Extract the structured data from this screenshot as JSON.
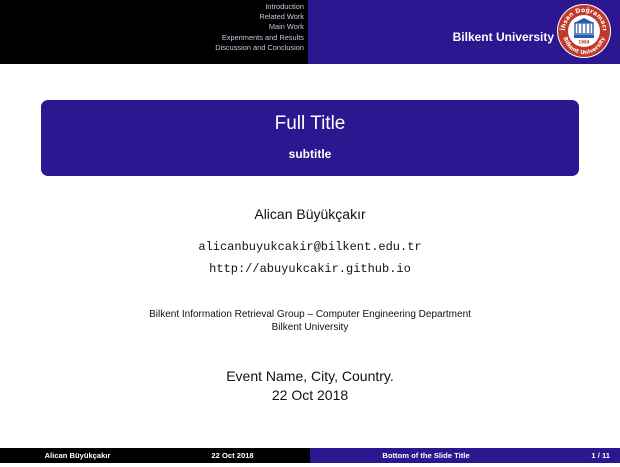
{
  "header": {
    "nav_items": [
      "Introduction",
      "Related Work",
      "Main Work",
      "Experiments and Results",
      "Discussion and Conclusion"
    ],
    "university": "Bilkent University",
    "logo": {
      "top_text": "İhsan Doğramacı",
      "bottom_text": "Bilkent University",
      "year": "1984",
      "colors": {
        "ring": "#c0392b",
        "inner": "#ffffff",
        "seal": "#2a5ba8"
      }
    }
  },
  "title": {
    "main": "Full Title",
    "subtitle": "subtitle"
  },
  "author": {
    "name": "Alican Büyükçakır",
    "email": "alicanbuyukcakir@bilkent.edu.tr",
    "url": "http://abuyukcakir.github.io"
  },
  "institute": {
    "line1": "Bilkent Information Retrieval Group – Computer Engineering Department",
    "line2": "Bilkent University"
  },
  "event": {
    "name": "Event Name, City, Country.",
    "date": "22 Oct 2018"
  },
  "footer": {
    "author": "Alican Büyükçakır",
    "date": "22 Oct 2018",
    "short_title": "Bottom of the Slide Title",
    "page": "1 / 11"
  },
  "colors": {
    "primary": "#2b1890",
    "header_dark": "#000000",
    "nav_text": "#c9c6da"
  }
}
